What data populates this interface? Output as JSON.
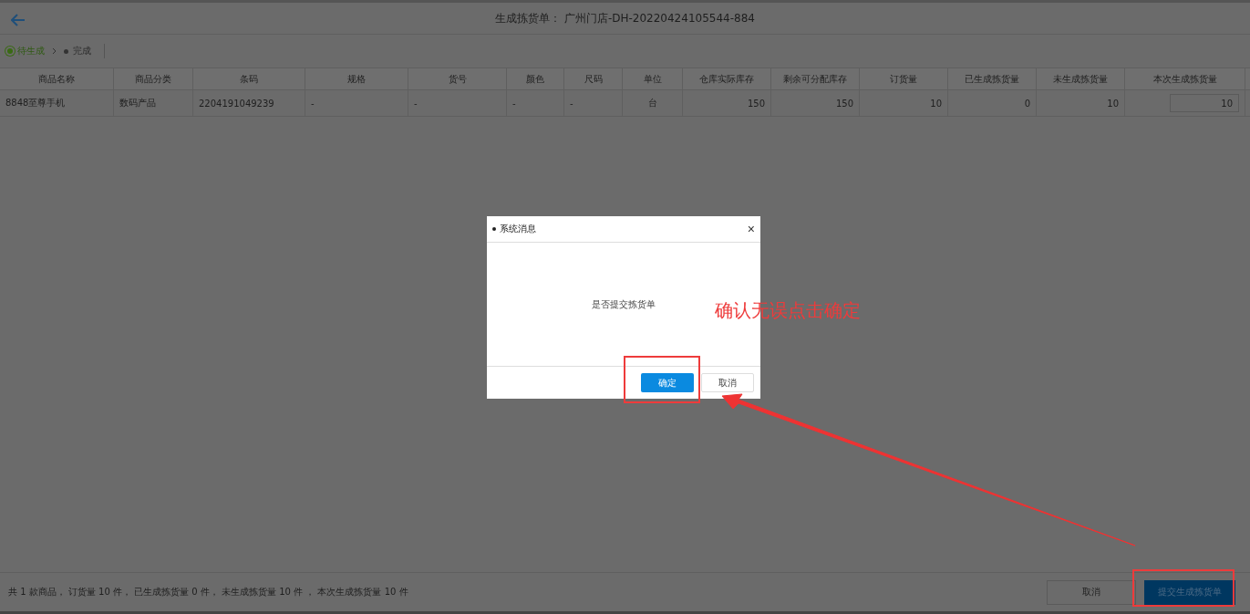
{
  "header": {
    "title": "生成拣货单：  广州门店-DH-20220424105544-884"
  },
  "steps": [
    {
      "label": "待生成",
      "selected": true
    },
    {
      "label": "完成",
      "selected": false
    }
  ],
  "table": {
    "columns": [
      "商品名称",
      "商品分类",
      "条码",
      "规格",
      "货号",
      "颜色",
      "尺码",
      "单位",
      "仓库实际库存",
      "剩余可分配库存",
      "订货量",
      "已生成拣货量",
      "未生成拣货量",
      "本次生成拣货量"
    ],
    "rows": [
      {
        "cells": [
          "8848至尊手机",
          "数码产品",
          "2204191049239",
          "-",
          "-",
          "-",
          "-",
          "台",
          "150",
          "150",
          "10",
          "0",
          "10"
        ],
        "input_value": "10"
      }
    ]
  },
  "footer": {
    "summary": "共 1 款商品， 订货量 10 件， 已生成拣货量 0 件， 未生成拣货量 10 件 ， 本次生成拣货量 10 件",
    "buttons": [
      "取消",
      "提交生成拣货单"
    ]
  },
  "dialog": {
    "title": "系统消息",
    "close": "×",
    "message": "是否提交拣货单",
    "buttons": [
      "确定",
      "取消"
    ]
  },
  "annotation": {
    "text": "确认无误点击确定"
  }
}
